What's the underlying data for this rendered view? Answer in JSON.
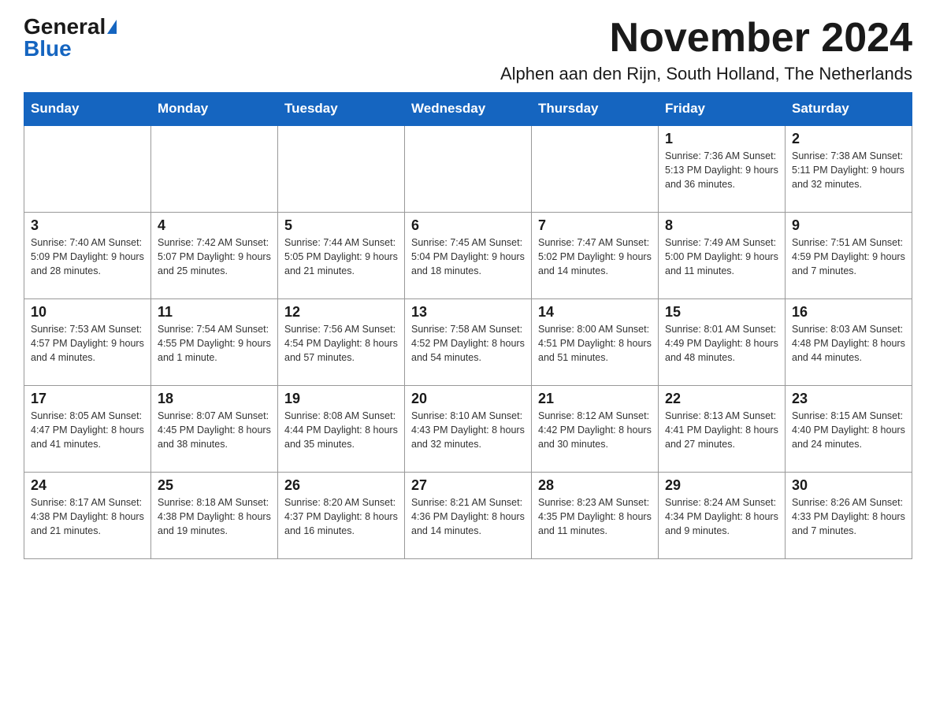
{
  "logo": {
    "general": "General",
    "blue": "Blue"
  },
  "title": {
    "month": "November 2024",
    "location": "Alphen aan den Rijn, South Holland, The Netherlands"
  },
  "days_of_week": [
    "Sunday",
    "Monday",
    "Tuesday",
    "Wednesday",
    "Thursday",
    "Friday",
    "Saturday"
  ],
  "weeks": [
    [
      {
        "day": "",
        "info": ""
      },
      {
        "day": "",
        "info": ""
      },
      {
        "day": "",
        "info": ""
      },
      {
        "day": "",
        "info": ""
      },
      {
        "day": "",
        "info": ""
      },
      {
        "day": "1",
        "info": "Sunrise: 7:36 AM\nSunset: 5:13 PM\nDaylight: 9 hours and 36 minutes."
      },
      {
        "day": "2",
        "info": "Sunrise: 7:38 AM\nSunset: 5:11 PM\nDaylight: 9 hours and 32 minutes."
      }
    ],
    [
      {
        "day": "3",
        "info": "Sunrise: 7:40 AM\nSunset: 5:09 PM\nDaylight: 9 hours and 28 minutes."
      },
      {
        "day": "4",
        "info": "Sunrise: 7:42 AM\nSunset: 5:07 PM\nDaylight: 9 hours and 25 minutes."
      },
      {
        "day": "5",
        "info": "Sunrise: 7:44 AM\nSunset: 5:05 PM\nDaylight: 9 hours and 21 minutes."
      },
      {
        "day": "6",
        "info": "Sunrise: 7:45 AM\nSunset: 5:04 PM\nDaylight: 9 hours and 18 minutes."
      },
      {
        "day": "7",
        "info": "Sunrise: 7:47 AM\nSunset: 5:02 PM\nDaylight: 9 hours and 14 minutes."
      },
      {
        "day": "8",
        "info": "Sunrise: 7:49 AM\nSunset: 5:00 PM\nDaylight: 9 hours and 11 minutes."
      },
      {
        "day": "9",
        "info": "Sunrise: 7:51 AM\nSunset: 4:59 PM\nDaylight: 9 hours and 7 minutes."
      }
    ],
    [
      {
        "day": "10",
        "info": "Sunrise: 7:53 AM\nSunset: 4:57 PM\nDaylight: 9 hours and 4 minutes."
      },
      {
        "day": "11",
        "info": "Sunrise: 7:54 AM\nSunset: 4:55 PM\nDaylight: 9 hours and 1 minute."
      },
      {
        "day": "12",
        "info": "Sunrise: 7:56 AM\nSunset: 4:54 PM\nDaylight: 8 hours and 57 minutes."
      },
      {
        "day": "13",
        "info": "Sunrise: 7:58 AM\nSunset: 4:52 PM\nDaylight: 8 hours and 54 minutes."
      },
      {
        "day": "14",
        "info": "Sunrise: 8:00 AM\nSunset: 4:51 PM\nDaylight: 8 hours and 51 minutes."
      },
      {
        "day": "15",
        "info": "Sunrise: 8:01 AM\nSunset: 4:49 PM\nDaylight: 8 hours and 48 minutes."
      },
      {
        "day": "16",
        "info": "Sunrise: 8:03 AM\nSunset: 4:48 PM\nDaylight: 8 hours and 44 minutes."
      }
    ],
    [
      {
        "day": "17",
        "info": "Sunrise: 8:05 AM\nSunset: 4:47 PM\nDaylight: 8 hours and 41 minutes."
      },
      {
        "day": "18",
        "info": "Sunrise: 8:07 AM\nSunset: 4:45 PM\nDaylight: 8 hours and 38 minutes."
      },
      {
        "day": "19",
        "info": "Sunrise: 8:08 AM\nSunset: 4:44 PM\nDaylight: 8 hours and 35 minutes."
      },
      {
        "day": "20",
        "info": "Sunrise: 8:10 AM\nSunset: 4:43 PM\nDaylight: 8 hours and 32 minutes."
      },
      {
        "day": "21",
        "info": "Sunrise: 8:12 AM\nSunset: 4:42 PM\nDaylight: 8 hours and 30 minutes."
      },
      {
        "day": "22",
        "info": "Sunrise: 8:13 AM\nSunset: 4:41 PM\nDaylight: 8 hours and 27 minutes."
      },
      {
        "day": "23",
        "info": "Sunrise: 8:15 AM\nSunset: 4:40 PM\nDaylight: 8 hours and 24 minutes."
      }
    ],
    [
      {
        "day": "24",
        "info": "Sunrise: 8:17 AM\nSunset: 4:38 PM\nDaylight: 8 hours and 21 minutes."
      },
      {
        "day": "25",
        "info": "Sunrise: 8:18 AM\nSunset: 4:38 PM\nDaylight: 8 hours and 19 minutes."
      },
      {
        "day": "26",
        "info": "Sunrise: 8:20 AM\nSunset: 4:37 PM\nDaylight: 8 hours and 16 minutes."
      },
      {
        "day": "27",
        "info": "Sunrise: 8:21 AM\nSunset: 4:36 PM\nDaylight: 8 hours and 14 minutes."
      },
      {
        "day": "28",
        "info": "Sunrise: 8:23 AM\nSunset: 4:35 PM\nDaylight: 8 hours and 11 minutes."
      },
      {
        "day": "29",
        "info": "Sunrise: 8:24 AM\nSunset: 4:34 PM\nDaylight: 8 hours and 9 minutes."
      },
      {
        "day": "30",
        "info": "Sunrise: 8:26 AM\nSunset: 4:33 PM\nDaylight: 8 hours and 7 minutes."
      }
    ]
  ]
}
